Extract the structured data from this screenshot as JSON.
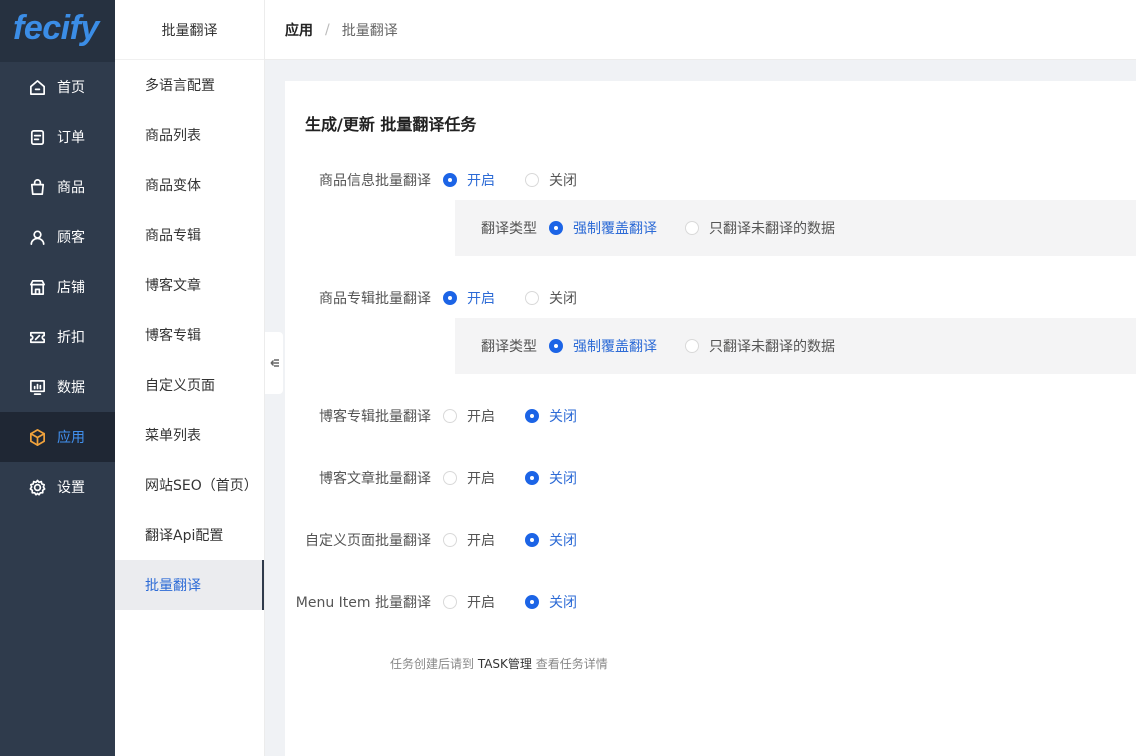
{
  "logo": {
    "text": "fecify"
  },
  "nav": [
    {
      "label": "首页",
      "icon": "home-icon"
    },
    {
      "label": "订单",
      "icon": "order-icon"
    },
    {
      "label": "商品",
      "icon": "bag-icon"
    },
    {
      "label": "顾客",
      "icon": "user-icon"
    },
    {
      "label": "店铺",
      "icon": "store-icon"
    },
    {
      "label": "折扣",
      "icon": "discount-icon"
    },
    {
      "label": "数据",
      "icon": "chart-icon"
    },
    {
      "label": "应用",
      "icon": "cube-icon",
      "active": true
    },
    {
      "label": "设置",
      "icon": "gear-icon"
    }
  ],
  "submenu": {
    "title": "批量翻译",
    "items": [
      "多语言配置",
      "商品列表",
      "商品变体",
      "商品专辑",
      "博客文章",
      "博客专辑",
      "自定义页面",
      "菜单列表",
      "网站SEO（首页）",
      "翻译Api配置",
      "批量翻译"
    ],
    "active_index": 10
  },
  "breadcrumb": {
    "root": "应用",
    "separator": "/",
    "current": "批量翻译"
  },
  "form": {
    "title": "生成/更新 批量翻译任务",
    "option_on": "开启",
    "option_off": "关闭",
    "rows": [
      {
        "label": "商品信息批量翻译",
        "value": "on"
      },
      {
        "label": "商品专辑批量翻译",
        "value": "on"
      },
      {
        "label": "博客专辑批量翻译",
        "value": "off"
      },
      {
        "label": "博客文章批量翻译",
        "value": "off"
      },
      {
        "label": "自定义页面批量翻译",
        "value": "off"
      },
      {
        "label": "Menu Item 批量翻译",
        "value": "off"
      }
    ],
    "subpanel": {
      "label": "翻译类型",
      "option_force": "强制覆盖翻译",
      "option_untranslated": "只翻译未翻译的数据",
      "selected": "force"
    },
    "footnote": {
      "prefix": "任务创建后请到 ",
      "link": "TASK管理",
      "suffix": " 查看任务详情"
    }
  },
  "colors": {
    "sidebar_bg": "#2f3b4c",
    "accent": "#1c64e6",
    "active_icon": "#f0a23c"
  }
}
